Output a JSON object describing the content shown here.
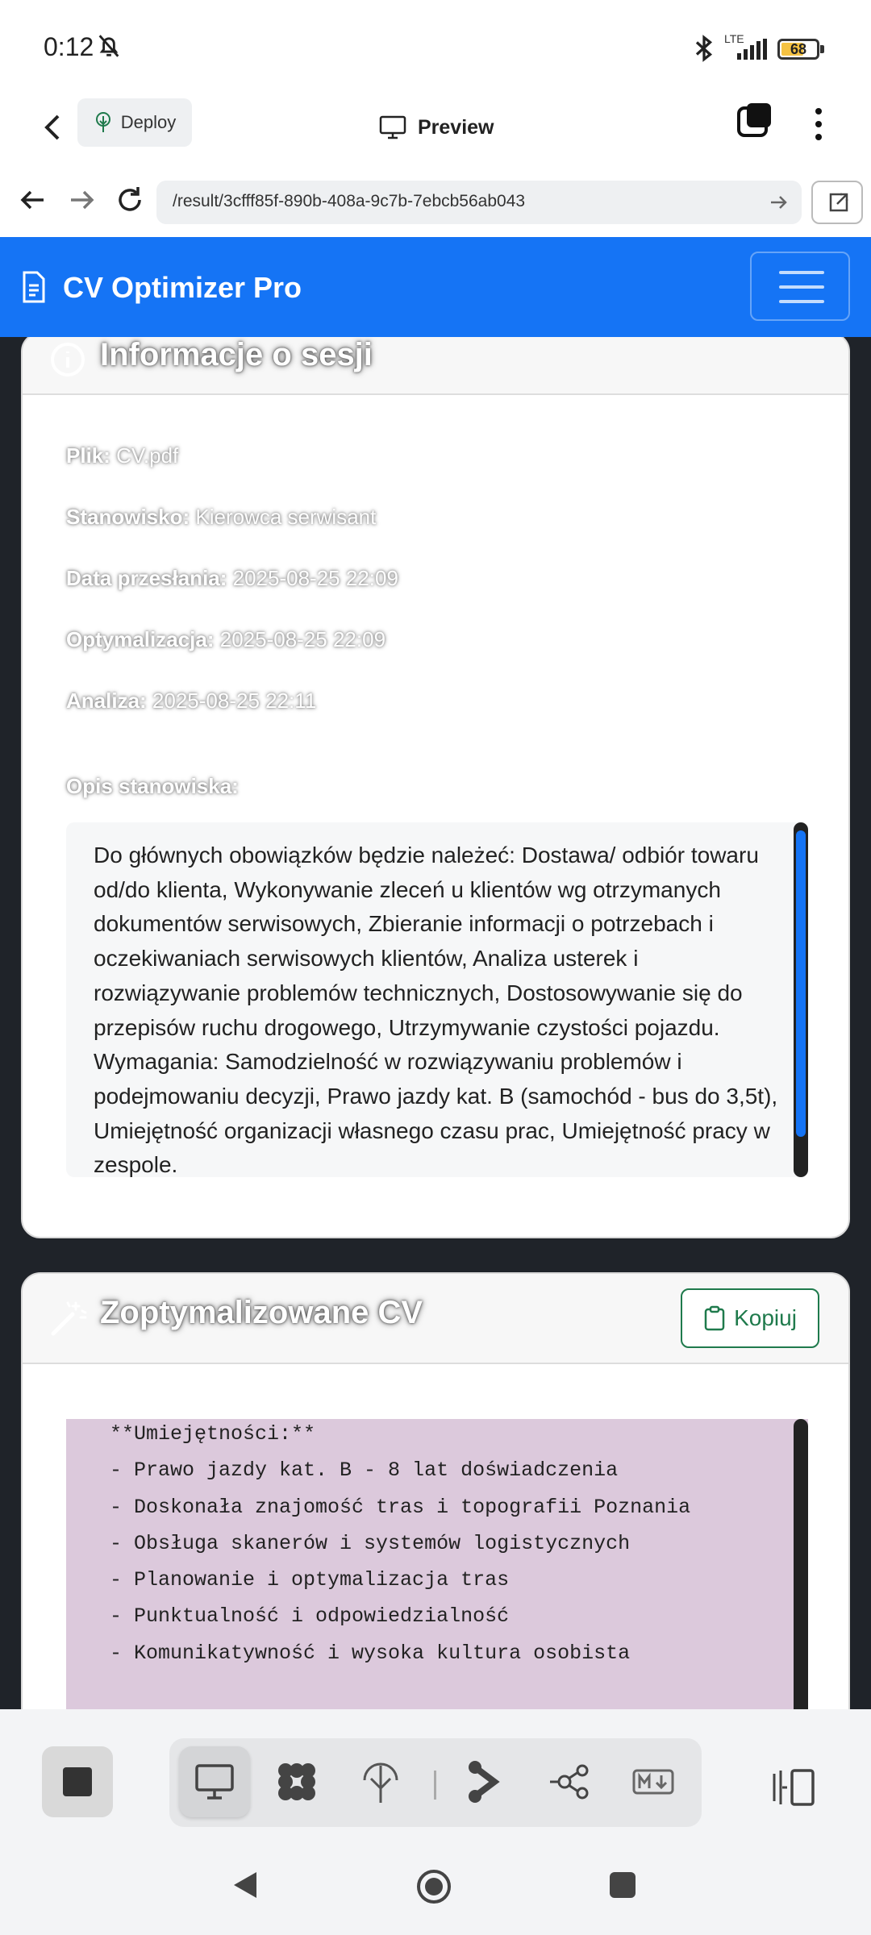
{
  "status": {
    "time": "0:12",
    "network": "LTE",
    "battery": "68",
    "battery_level": 0.68
  },
  "app_bar": {
    "deploy_label": "Deploy",
    "preview_label": "Preview"
  },
  "browser": {
    "url": "/result/3cfff85f-890b-408a-9c7b-7ebcb56ab043"
  },
  "site": {
    "brand": "CV Optimizer Pro"
  },
  "session": {
    "title": "Informacje o sesji",
    "file_label": "Plik:",
    "file_value": "CV.pdf",
    "position_label": "Stanowisko:",
    "position_value": "Kierowca serwisant",
    "upload_label": "Data przesłania:",
    "upload_value": "2025-08-25 22:09",
    "optimization_label": "Optymalizacja:",
    "optimization_value": "2025-08-25 22:09",
    "analysis_label": "Analiza:",
    "analysis_value": "2025-08-25 22:11",
    "description_label": "Opis stanowiska:",
    "description": "Do głównych obowiązków będzie należeć: Dostawa/ odbiór towaru od/do klienta, Wykonywanie zleceń u klientów wg otrzymanych dokumentów serwisowych, Zbieranie informacji o potrzebach i oczekiwaniach serwisowych klientów, Analiza usterek i rozwiązywanie problemów technicznych, Dostosowywanie się do przepisów ruchu drogowego, Utrzymywanie czystości pojazdu. Wymagania: Samodzielność w rozwiązywaniu problemów i podejmowaniu decyzji, Prawo jazdy kat. B (samochód - bus do 3,5t), Umiejętność organizacji własnego czasu prac, Umiejętność pracy w zespole."
  },
  "optimized_cv": {
    "title": "Zoptymalizowane CV",
    "copy_label": "Kopiuj",
    "text": "**Umiejętności:**\n- Prawo jazdy kat. B - 8 lat doświadczenia\n- Doskonała znajomość tras i topografii Poznania\n- Obsługa skanerów i systemów logistycznych\n- Planowanie i optymalizacja tras\n- Punktualność i odpowiedzialność\n- Komunikatywność i wysoka kultura osobista"
  },
  "icons": {
    "bell": "bell-muted-icon",
    "bluetooth": "bluetooth-icon",
    "back": "chevron-left-icon",
    "deploy": "tree-icon",
    "preview": "monitor-icon",
    "tabs": "tabs-icon",
    "more": "more-vertical-icon",
    "brand": "document-icon",
    "info": "info-icon",
    "wand": "magic-wand-icon",
    "copy": "clipboard-icon"
  },
  "colors": {
    "brand_blue": "#1574f5",
    "copy_green": "#1f7a4c",
    "cv_background": "#dcc9dc",
    "battery": "#f5c242"
  }
}
